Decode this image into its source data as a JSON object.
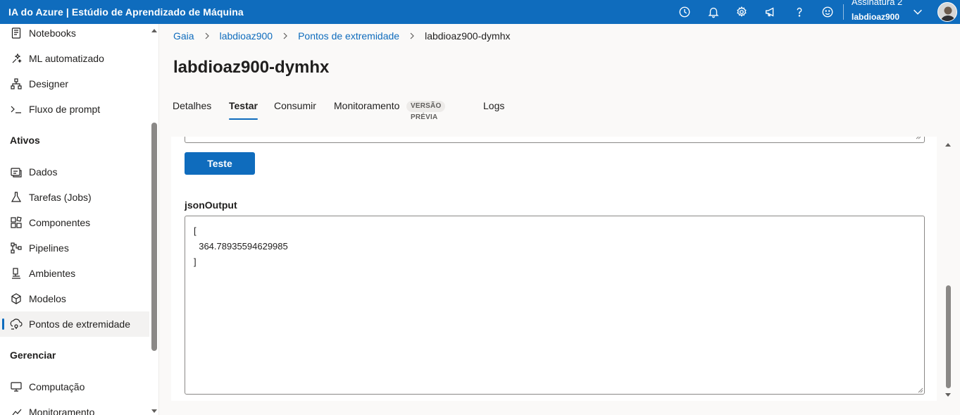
{
  "app": {
    "title": "IA do Azure | Estúdio de Aprendizado de Máquina"
  },
  "topbar": {
    "icons": [
      "clock-icon",
      "bell-icon",
      "gear-icon",
      "megaphone-icon",
      "help-icon",
      "smiley-icon"
    ],
    "subscription": "Assinatura 2",
    "workspace": "labdioaz900"
  },
  "sidebar": {
    "items_top": [
      {
        "label": "Notebooks",
        "icon": "notebook-icon"
      },
      {
        "label": "ML automatizado",
        "icon": "automl-icon"
      },
      {
        "label": "Designer",
        "icon": "designer-icon"
      },
      {
        "label": "Fluxo de prompt",
        "icon": "prompt-flow-icon"
      }
    ],
    "section_assets": "Ativos",
    "items_assets": [
      {
        "label": "Dados",
        "icon": "data-icon"
      },
      {
        "label": "Tarefas (Jobs)",
        "icon": "flask-icon"
      },
      {
        "label": "Componentes",
        "icon": "components-icon"
      },
      {
        "label": "Pipelines",
        "icon": "pipelines-icon"
      },
      {
        "label": "Ambientes",
        "icon": "environments-icon"
      },
      {
        "label": "Modelos",
        "icon": "models-icon"
      },
      {
        "label": "Pontos de extremidade",
        "icon": "endpoints-icon"
      }
    ],
    "section_manage": "Gerenciar",
    "items_manage": [
      {
        "label": "Computação",
        "icon": "compute-icon"
      },
      {
        "label": "Monitoramento",
        "icon": "monitoring-icon"
      }
    ]
  },
  "breadcrumb": {
    "home": "Gaia",
    "workspace": "labdioaz900",
    "section": "Pontos de extremidade",
    "current": "labdioaz900-dymhx"
  },
  "page": {
    "title": "labdioaz900-dymhx"
  },
  "tabs": {
    "details": "Detalhes",
    "test": "Testar",
    "consume": "Consumir",
    "monitoring": "Monitoramento",
    "preview_badge": "VERSÃO PRÉVIA",
    "logs": "Logs"
  },
  "test_panel": {
    "test_button": "Teste",
    "output_label": "jsonOutput",
    "output_value": "[\n  364.78935594629985\n]"
  },
  "colors": {
    "accent": "#0f6cbd"
  }
}
